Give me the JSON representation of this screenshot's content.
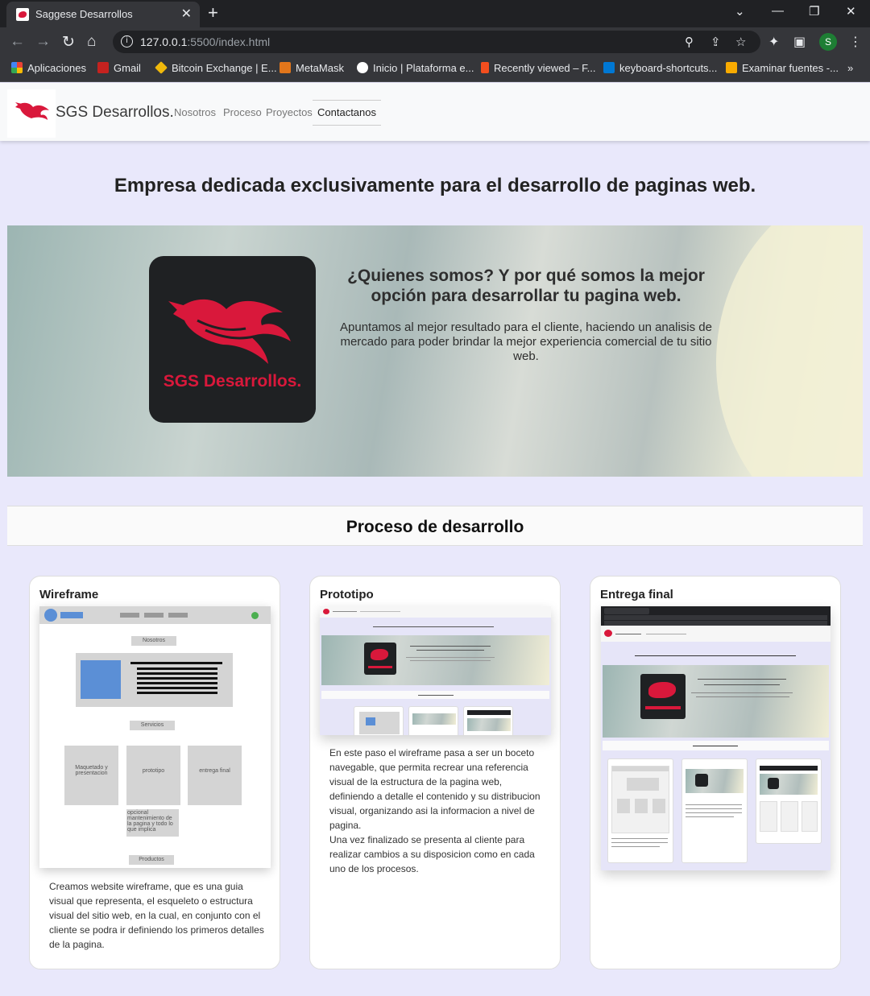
{
  "browser": {
    "tab_title": "Saggese Desarrollos",
    "tab_close": "✕",
    "new_tab": "+",
    "url_host": "127.0.0.1",
    "url_path": ":5500/index.html",
    "profile_initial": "S",
    "window_controls": {
      "minimize": "—",
      "restore": "❐",
      "close": "✕",
      "tab_search": "⌄"
    },
    "nav": {
      "back": "←",
      "forward": "→",
      "reload": "↻",
      "home": "⌂"
    },
    "bookmarks": [
      {
        "label": "Aplicaciones",
        "color": "#ea4335"
      },
      {
        "label": "Gmail",
        "color": "#c5221f"
      },
      {
        "label": "Bitcoin Exchange | E...",
        "color": "#f0b90b"
      },
      {
        "label": "MetaMask",
        "color": "#e2761b"
      },
      {
        "label": "Inicio | Plataforma e...",
        "color": "#ffffff"
      },
      {
        "label": "Recently viewed – F...",
        "color": "#f24e1e"
      },
      {
        "label": "keyboard-shortcuts...",
        "color": "#0078d4"
      },
      {
        "label": "Examinar fuentes -...",
        "color": "#f9ab00"
      }
    ],
    "bookmarks_more": "»"
  },
  "site": {
    "brand": "SGS Desarrollos.",
    "nav_links": [
      "Nosotros",
      "Proceso",
      "Proyectos",
      "Contactanos"
    ],
    "headline": "Empresa dedicada exclusivamente para el desarrollo de paginas web.",
    "hero": {
      "logo_text": "SGS Desarrollos.",
      "title": "¿Quienes somos? Y por qué somos la mejor opción para desarrollar tu pagina web.",
      "text": "Apuntamos al mejor resultado para el cliente, haciendo un analisis de mercado para poder brindar la mejor experiencia comercial de tu sitio web."
    },
    "process_title": "Proceso de desarrollo",
    "cards": [
      {
        "title": "Wireframe",
        "text": "Creamos website wireframe, que es una guia visual que representa, el esqueleto o estructura visual del sitio web, en la cual, en conjunto con el cliente se podra ir definiendo los primeros detalles de la pagina."
      },
      {
        "title": "Prototipo",
        "text": "En este paso el wireframe pasa a ser un boceto navegable, que permita recrear una referencia visual de la estructura de la pagina web, definiendo a detalle el contenido y su distribucion visual, organizando asi la informacion a nivel de pagina.\nUna vez finalizado se presenta al cliente para realizar cambios a su disposicion como en cada uno de los procesos."
      },
      {
        "title": "Entrega final"
      }
    ],
    "wireframe_labels": {
      "nosotros": "Nosotros",
      "servicios": "Servicios",
      "box1": "Maquetado y presentacion",
      "box2": "prototipo",
      "box3": "entrega final",
      "optional": "opcional mantenimiento de la pagina y todo lo que implica",
      "productos": "Productos"
    }
  },
  "colors": {
    "accent": "#d9183b",
    "logo_bg": "#1f2123"
  }
}
